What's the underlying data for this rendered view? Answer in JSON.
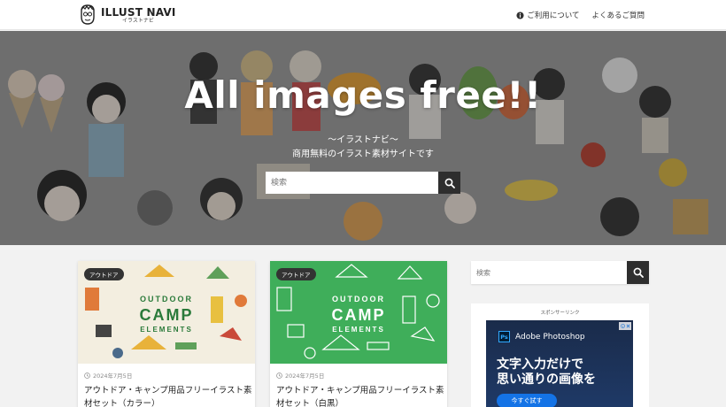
{
  "header": {
    "logo_title": "ILLUST NAVI",
    "logo_sub": "イラストナビ",
    "nav": [
      {
        "label": "ご利用について",
        "icon": "info-icon"
      },
      {
        "label": "よくあるご質問",
        "icon": ""
      }
    ]
  },
  "hero": {
    "title": "All images free!!",
    "subtitle1": "〜イラストナビ〜",
    "subtitle2": "商用無料のイラスト素材サイトです",
    "search_placeholder": "検索"
  },
  "cards": [
    {
      "badge": "アウトドア",
      "date": "2024年7月5日",
      "title": "アウトドア・キャンプ用品フリーイラスト素材セット（カラー）",
      "thumb_text": [
        "OUTDOOR",
        "CAMP",
        "ELEMENTS"
      ],
      "thumb_bg": "#f3eee0"
    },
    {
      "badge": "アウトドア",
      "date": "2024年7月5日",
      "title": "アウトドア・キャンプ用品フリーイラスト素材セット（白黒）",
      "thumb_text": [
        "OUTDOOR",
        "CAMP",
        "ELEMENTS"
      ],
      "thumb_bg": "#3fae5a"
    }
  ],
  "sidebar": {
    "search_placeholder": "検索",
    "sponsor_label": "スポンサーリンク",
    "ad": {
      "brand": "Adobe Photoshop",
      "line1": "文字入力だけで",
      "line2": "思い通りの画像を",
      "cta": "今すぐ試す"
    }
  },
  "colors": {
    "dark_button": "#2e2e2e",
    "badge": "#333333",
    "card2_green": "#3fae5a"
  }
}
